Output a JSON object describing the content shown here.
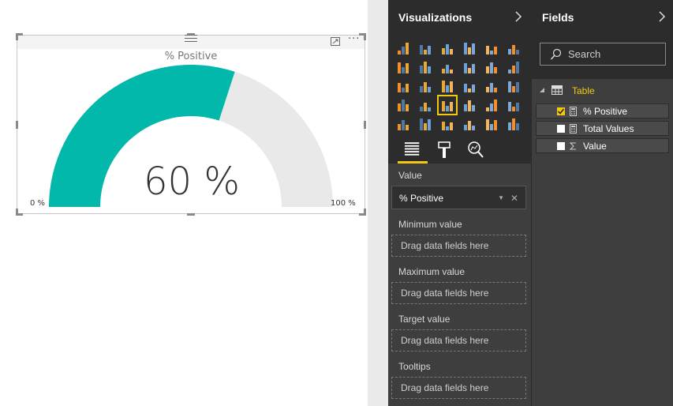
{
  "colors": {
    "gauge_fill": "#01b8aa",
    "gauge_track": "#e9e9e9",
    "accent": "#f2c811"
  },
  "gauge": {
    "title": "% Positive",
    "value_text": "60 %",
    "min_label": "0 %",
    "max_label": "100 %",
    "fill_fraction": 0.6
  },
  "visualizations": {
    "title": "Visualizations",
    "icons": [
      "stacked-bar-icon",
      "stacked-column-icon",
      "clustered-bar-icon",
      "clustered-column-icon",
      "100-bar-icon",
      "100-column-icon",
      "line-chart-icon",
      "area-chart-icon",
      "stacked-area-icon",
      "line-column-icon",
      "line-clustered-icon",
      "ribbon-chart-icon",
      "scatter-icon",
      "pie-chart-icon",
      "treemap-icon",
      "map-icon",
      "table-icon",
      "matrix-icon",
      "filled-map-icon",
      "funnel-icon",
      "gauge-icon",
      "multirow-card-icon",
      "card-icon",
      "kpi-icon",
      "slicer-icon",
      "donut-icon",
      "r-visual-icon",
      "shape-map-icon",
      "table-grid-icon",
      "globe-icon"
    ],
    "selected_index": 20,
    "tabs": [
      "fields-tab-icon",
      "format-tab-icon",
      "analytics-tab-icon"
    ],
    "wells": {
      "value_label": "Value",
      "value_field": "% Positive",
      "min_label": "Minimum value",
      "max_label": "Maximum value",
      "target_label": "Target value",
      "tooltips_label": "Tooltips",
      "placeholder": "Drag data fields here"
    }
  },
  "fields": {
    "title": "Fields",
    "search_placeholder": "Search",
    "table_name": "Table",
    "items": [
      {
        "label": "% Positive",
        "checked": true
      },
      {
        "label": "Total Values",
        "checked": false
      },
      {
        "label": "Value",
        "checked": false
      }
    ]
  }
}
